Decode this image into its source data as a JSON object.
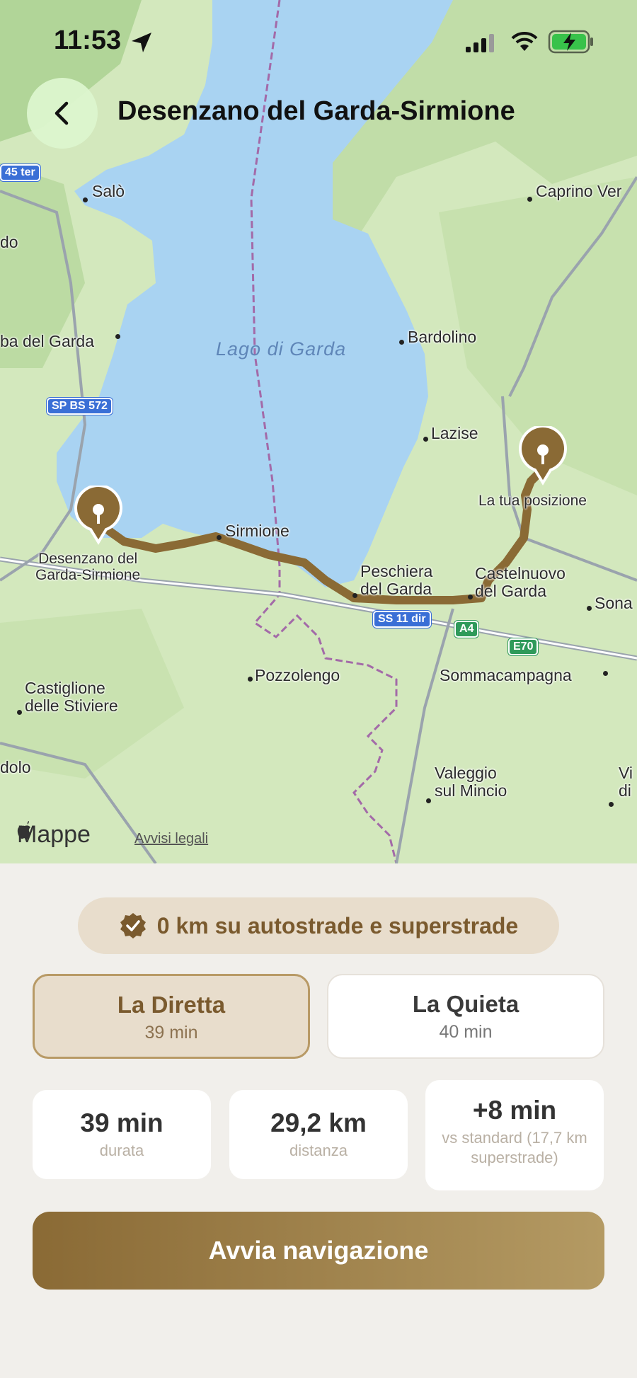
{
  "status": {
    "time": "11:53"
  },
  "header": {
    "title": "Desenzano del Garda-Sirmione"
  },
  "map": {
    "lake": "Lago di\nGarda",
    "places": [
      "Salò",
      "Caprino Ver",
      "do",
      "ba del Garda",
      "Bardolino",
      "Lazise",
      "La tua posizione",
      "Desenzano del\nGarda-Sirmione",
      "Sirmione",
      "Peschiera\ndel Garda",
      "Castelnuovo\ndel Garda",
      "Sona",
      "Pozzolengo",
      "Sommacampagna",
      "Castiglione\ndelle Stiviere",
      "dolo",
      "Valeggio\nsul Mincio",
      "Vi\ndi"
    ],
    "shields": [
      "45 ter",
      "SP BS 572",
      "SS 11 dir",
      "A4",
      "E70"
    ],
    "attribution": "Mappe",
    "legal": "Avvisi legali"
  },
  "sheet": {
    "chip": "0 km su autostrade e superstrade",
    "routes": [
      {
        "name": "La Diretta",
        "time": "39 min"
      },
      {
        "name": "La Quieta",
        "time": "40 min"
      }
    ],
    "stats": [
      {
        "value": "39 min",
        "label": "durata"
      },
      {
        "value": "29,2 km",
        "label": "distanza"
      },
      {
        "value": "+8 min",
        "label": "vs standard (17,7 km superstrade)"
      }
    ],
    "start_button": "Avvia navigazione"
  },
  "colors": {
    "route": "#8a6a35",
    "accent_bg": "#e8ddcc",
    "lake": "#a9d3f2",
    "land": "#cfe5b8"
  },
  "icons": [
    "location-arrow-icon",
    "signal-icon",
    "wifi-icon",
    "battery-charging-icon",
    "back-chevron-icon",
    "pin-icon",
    "verified-badge-icon",
    "apple-logo-icon"
  ]
}
